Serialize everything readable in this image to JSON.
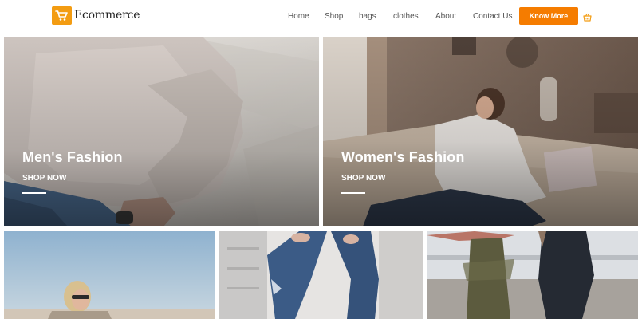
{
  "brand": {
    "name": "Ecommerce",
    "logo_icon": "shopping-cart-icon",
    "accent": "#f39c12"
  },
  "nav": {
    "items": [
      {
        "label": "Home"
      },
      {
        "label": "Shop"
      },
      {
        "label": "bags"
      },
      {
        "label": "clothes"
      },
      {
        "label": "About"
      },
      {
        "label": "Contact Us"
      }
    ],
    "cta_label": "Know More",
    "cta_color": "#f57c00",
    "cart_icon": "basket-icon"
  },
  "tiles": {
    "men": {
      "title": "Men's Fashion",
      "cta": "SHOP NOW"
    },
    "women": {
      "title": "Women's Fashion",
      "cta": "SHOP NOW"
    }
  }
}
